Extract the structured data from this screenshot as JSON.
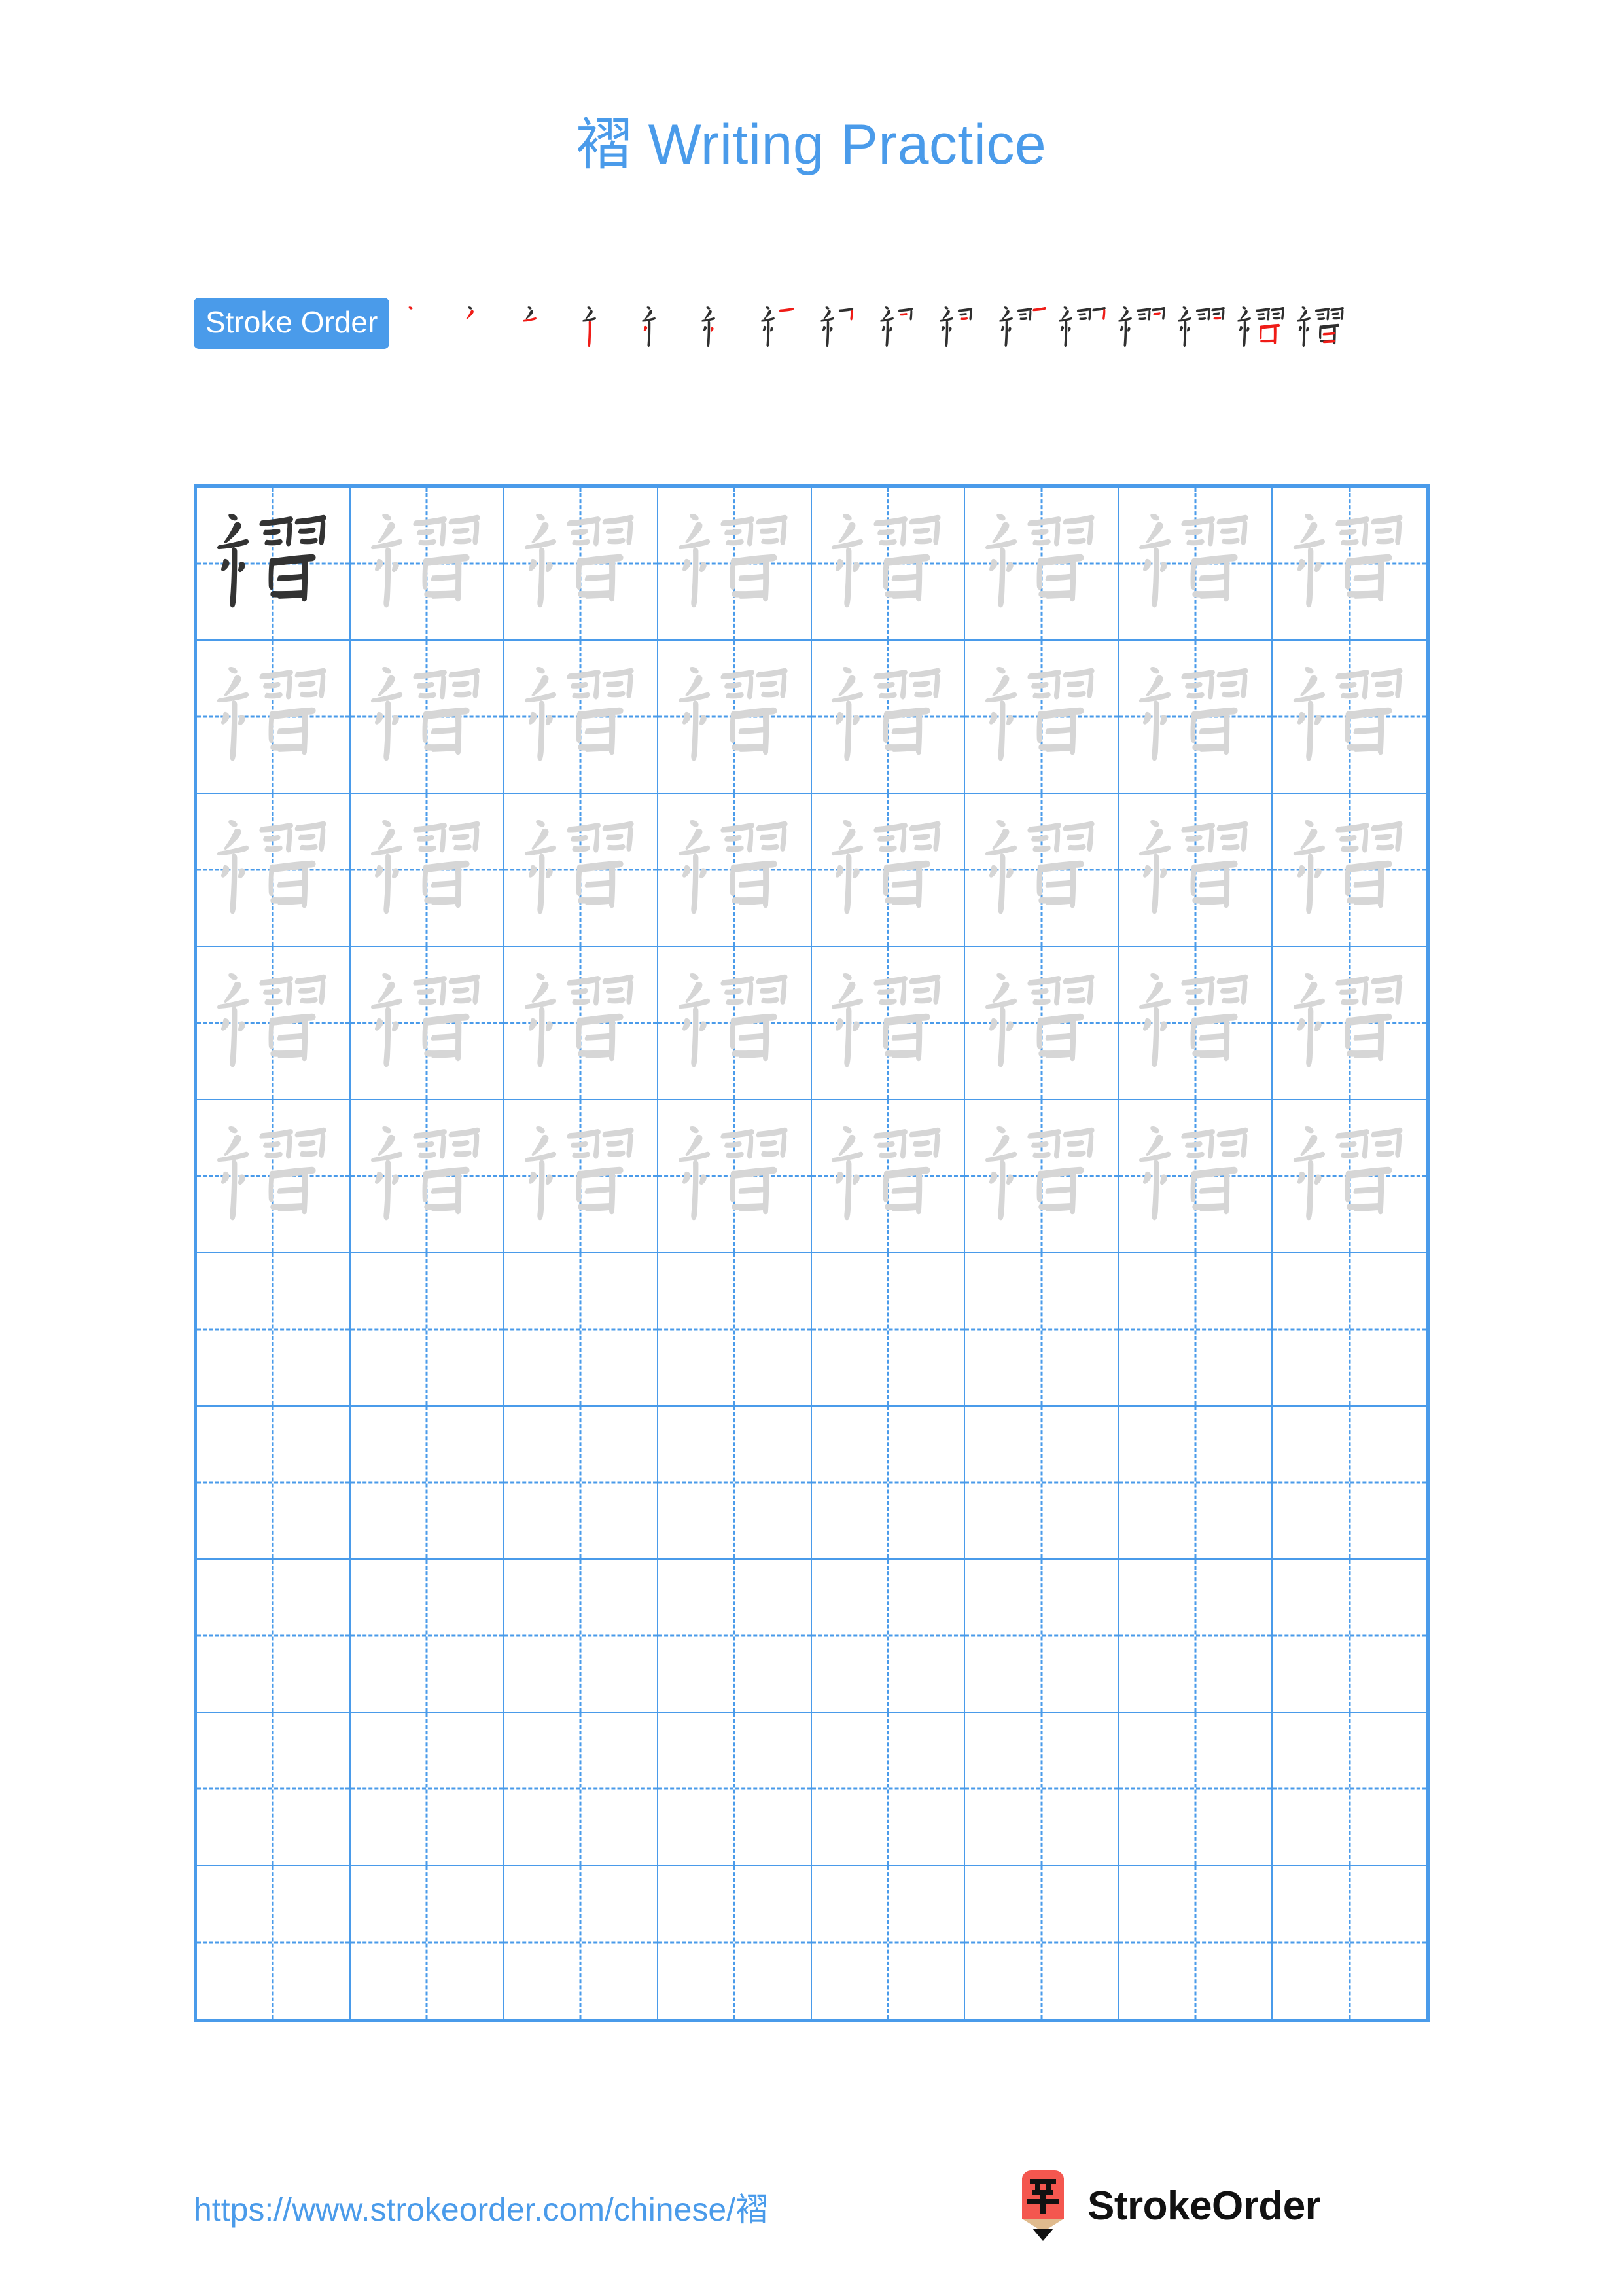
{
  "page": {
    "character": "褶",
    "title": "褶 Writing Practice",
    "background_color": "#ffffff",
    "accent_color": "#4a9bea",
    "new_stroke_color": "#ef1c17",
    "done_stroke_color": "#2f2f2f",
    "trace_glyph_color": "#d6d6d6",
    "model_glyph_color": "#333333"
  },
  "stroke_order": {
    "label": "Stroke Order",
    "total_strokes": 16,
    "steps": [
      {
        "index": 1,
        "strokes_shown": 1
      },
      {
        "index": 2,
        "strokes_shown": 2
      },
      {
        "index": 3,
        "strokes_shown": 3
      },
      {
        "index": 4,
        "strokes_shown": 4
      },
      {
        "index": 5,
        "strokes_shown": 5
      },
      {
        "index": 6,
        "strokes_shown": 6
      },
      {
        "index": 7,
        "strokes_shown": 7
      },
      {
        "index": 8,
        "strokes_shown": 8
      },
      {
        "index": 9,
        "strokes_shown": 9
      },
      {
        "index": 10,
        "strokes_shown": 10
      },
      {
        "index": 11,
        "strokes_shown": 11
      },
      {
        "index": 12,
        "strokes_shown": 12
      },
      {
        "index": 13,
        "strokes_shown": 13
      },
      {
        "index": 14,
        "strokes_shown": 14
      },
      {
        "index": 15,
        "strokes_shown": 15
      },
      {
        "index": 16,
        "strokes_shown": 16
      }
    ]
  },
  "practice_grid": {
    "columns": 8,
    "rows": 10,
    "cells": [
      [
        "model",
        "trace",
        "trace",
        "trace",
        "trace",
        "trace",
        "trace",
        "trace"
      ],
      [
        "trace",
        "trace",
        "trace",
        "trace",
        "trace",
        "trace",
        "trace",
        "trace"
      ],
      [
        "trace",
        "trace",
        "trace",
        "trace",
        "trace",
        "trace",
        "trace",
        "trace"
      ],
      [
        "trace",
        "trace",
        "trace",
        "trace",
        "trace",
        "trace",
        "trace",
        "trace"
      ],
      [
        "trace",
        "trace",
        "trace",
        "trace",
        "trace",
        "trace",
        "trace",
        "trace"
      ],
      [
        "empty",
        "empty",
        "empty",
        "empty",
        "empty",
        "empty",
        "empty",
        "empty"
      ],
      [
        "empty",
        "empty",
        "empty",
        "empty",
        "empty",
        "empty",
        "empty",
        "empty"
      ],
      [
        "empty",
        "empty",
        "empty",
        "empty",
        "empty",
        "empty",
        "empty",
        "empty"
      ],
      [
        "empty",
        "empty",
        "empty",
        "empty",
        "empty",
        "empty",
        "empty",
        "empty"
      ],
      [
        "empty",
        "empty",
        "empty",
        "empty",
        "empty",
        "empty",
        "empty",
        "empty"
      ]
    ]
  },
  "footer": {
    "url": "https://www.strokeorder.com/chinese/褶",
    "brand_name": "StrokeOrder",
    "brand_mark_character": "字",
    "brand_mark_color": "#f4574f",
    "brand_mark_wood_color": "#e0bb8e"
  }
}
